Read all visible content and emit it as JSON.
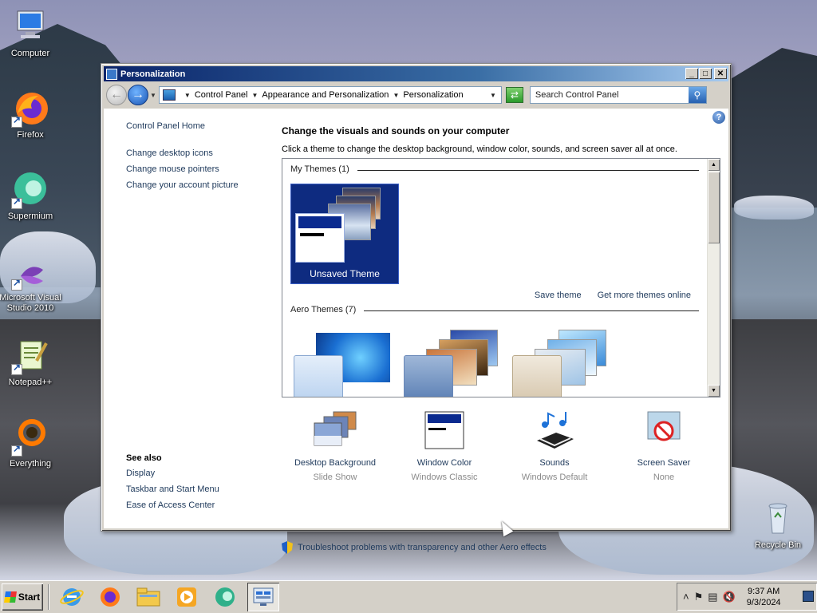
{
  "desktop": {
    "icons": [
      {
        "label": "Computer",
        "icon": "computer-icon"
      },
      {
        "label": "Firefox",
        "icon": "firefox-icon"
      },
      {
        "label": "Supermium",
        "icon": "supermium-icon"
      },
      {
        "label": "Microsoft Visual Studio 2010",
        "icon": "visual-studio-icon"
      },
      {
        "label": "Notepad++",
        "icon": "notepadpp-icon"
      },
      {
        "label": "Everything",
        "icon": "everything-icon"
      },
      {
        "label": "Recycle Bin",
        "icon": "recycle-bin-icon"
      }
    ]
  },
  "window": {
    "title": "Personalization",
    "caption_buttons": {
      "minimize": "_",
      "maximize": "□",
      "close": "✕"
    },
    "breadcrumb": [
      "Control Panel",
      "Appearance and Personalization",
      "Personalization"
    ],
    "search_placeholder": "Search Control Panel",
    "help": "?"
  },
  "left_pane": {
    "home": "Control Panel Home",
    "links": [
      "Change desktop icons",
      "Change mouse pointers",
      "Change your account picture"
    ],
    "see_also_title": "See also",
    "see_also": [
      "Display",
      "Taskbar and Start Menu",
      "Ease of Access Center"
    ]
  },
  "main": {
    "title": "Change the visuals and sounds on your computer",
    "subtitle": "Click a theme to change the desktop background, window color, sounds, and screen saver all at once.",
    "my_themes_label": "My Themes (1)",
    "unsaved_theme": "Unsaved Theme",
    "save_theme": "Save theme",
    "get_more_themes": "Get more themes online",
    "aero_themes_label": "Aero Themes (7)",
    "bottom": [
      {
        "label": "Desktop Background",
        "sub": "Slide Show",
        "icon": "desktop-background-icon"
      },
      {
        "label": "Window Color",
        "sub": "Windows Classic",
        "icon": "window-color-icon"
      },
      {
        "label": "Sounds",
        "sub": "Windows Default",
        "icon": "sounds-icon"
      },
      {
        "label": "Screen Saver",
        "sub": "None",
        "icon": "screen-saver-icon"
      }
    ],
    "troubleshoot": "Troubleshoot problems with transparency and other Aero effects"
  },
  "taskbar": {
    "start_label": "Start",
    "apps": [
      "internet-explorer-icon",
      "firefox-icon",
      "file-explorer-icon",
      "media-player-icon",
      "supermium-icon",
      "control-panel-icon"
    ],
    "time": "9:37 AM",
    "date": "9/3/2024"
  }
}
